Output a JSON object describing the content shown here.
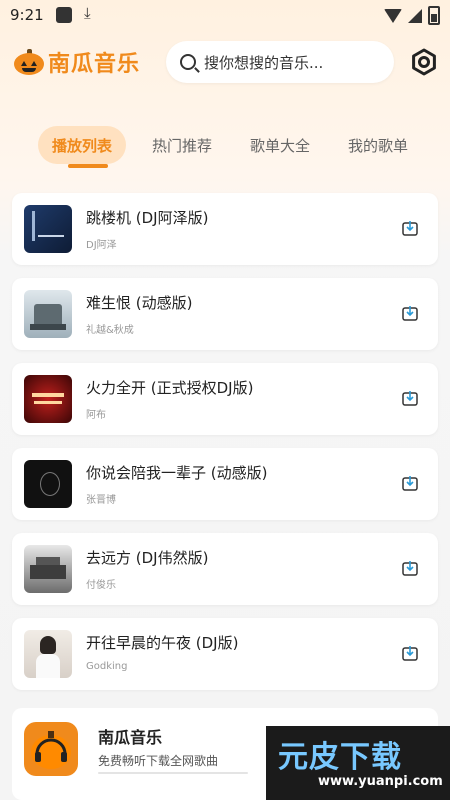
{
  "status": {
    "time": "9:21"
  },
  "header": {
    "app_name": "南瓜音乐",
    "search_placeholder": "搜你想搜的音乐..."
  },
  "tabs": [
    {
      "label": "播放列表",
      "active": true
    },
    {
      "label": "热门推荐",
      "active": false
    },
    {
      "label": "歌单大全",
      "active": false
    },
    {
      "label": "我的歌单",
      "active": false
    }
  ],
  "songs": [
    {
      "title": "跳楼机 (DJ阿泽版)",
      "artist": "DJ阿泽"
    },
    {
      "title": "难生恨 (动感版)",
      "artist": "礼越&秋成"
    },
    {
      "title": "火力全开 (正式授权DJ版)",
      "artist": "阿布"
    },
    {
      "title": "你说会陪我一辈子 (动感版)",
      "artist": "张晋博"
    },
    {
      "title": "去远方 (DJ伟然版)",
      "artist": "付俊乐"
    },
    {
      "title": "开往早晨的午夜 (DJ版)",
      "artist": "Godking"
    }
  ],
  "banner": {
    "title": "南瓜音乐",
    "subtitle": "免费畅听下载全网歌曲"
  },
  "watermark": {
    "main": "元皮下载",
    "url": "www.yuanpi.com"
  },
  "colors": {
    "accent": "#f08a1c",
    "tab_active_bg": "#ffe1c0",
    "background": "#f4f4f4"
  }
}
